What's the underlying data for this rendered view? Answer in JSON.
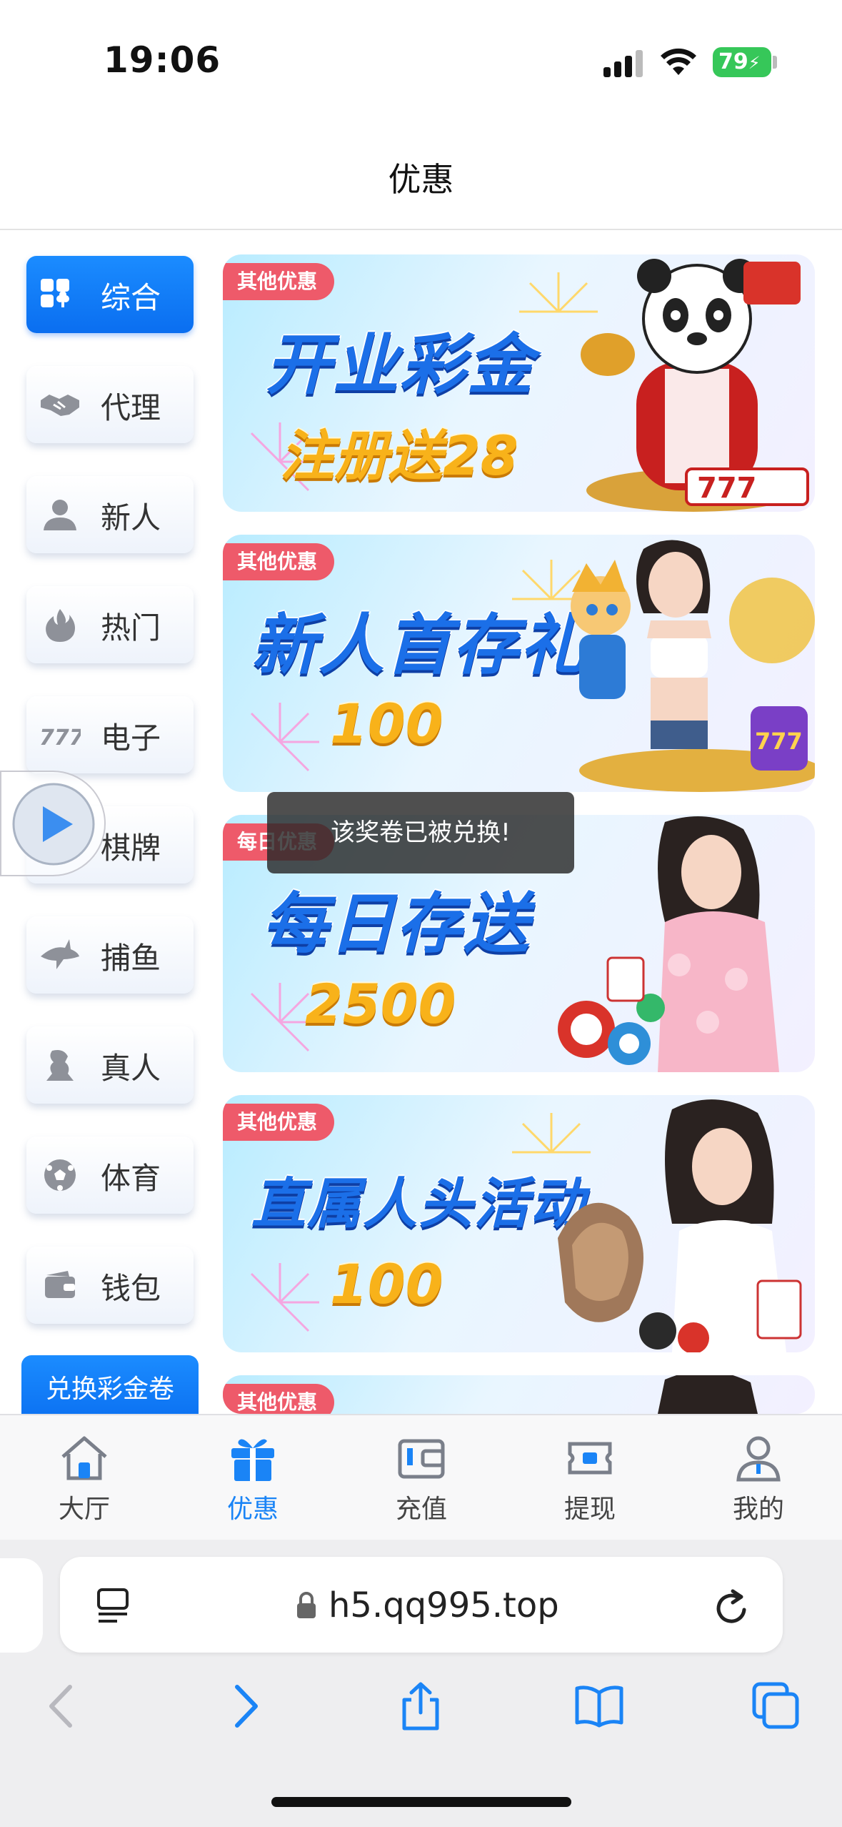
{
  "status_bar": {
    "time": "19:06",
    "battery": "79"
  },
  "header": {
    "title": "优惠"
  },
  "side_menu": {
    "items": [
      {
        "label": "综合",
        "icon": "grid-club-icon",
        "active": true
      },
      {
        "label": "代理",
        "icon": "handshake-icon",
        "active": false
      },
      {
        "label": "新人",
        "icon": "person-icon",
        "active": false
      },
      {
        "label": "热门",
        "icon": "fire-icon",
        "active": false
      },
      {
        "label": "电子",
        "icon": "slot-777-icon",
        "active": false
      },
      {
        "label": "棋牌",
        "icon": "cards-icon",
        "active": false
      },
      {
        "label": "捕鱼",
        "icon": "shark-icon",
        "active": false
      },
      {
        "label": "真人",
        "icon": "dealer-icon",
        "active": false
      },
      {
        "label": "体育",
        "icon": "soccer-ball-icon",
        "active": false
      },
      {
        "label": "钱包",
        "icon": "wallet-icon",
        "active": false
      }
    ],
    "redeem_label": "兑换彩金卷"
  },
  "banners": [
    {
      "tag": "其他优惠",
      "title": "开业彩金",
      "subtitle": "注册送28",
      "art": "panda-mascot"
    },
    {
      "tag": "其他优惠",
      "title": "新人首存礼",
      "subtitle": "100",
      "art": "girl-and-cartoon-boy"
    },
    {
      "tag": "每日优惠",
      "title": "每日存送",
      "subtitle": "2500",
      "art": "girl-with-chips"
    },
    {
      "tag": "其他优惠",
      "title": "直属人头活动",
      "subtitle": "100",
      "art": "girl-with-cards"
    },
    {
      "tag": "其他优惠",
      "title": "",
      "subtitle": "",
      "art": "girl-partial"
    }
  ],
  "toast": {
    "message": "该奖卷已被兑换!"
  },
  "bottom_nav": [
    {
      "label": "大厅",
      "icon": "home-icon",
      "active": false
    },
    {
      "label": "优惠",
      "icon": "gift-icon",
      "active": true
    },
    {
      "label": "充值",
      "icon": "deposit-wallet-icon",
      "active": false
    },
    {
      "label": "提现",
      "icon": "withdraw-icon",
      "active": false
    },
    {
      "label": "我的",
      "icon": "profile-icon",
      "active": false
    }
  ],
  "browser": {
    "url": "h5.qq995.top"
  },
  "colors": {
    "accent": "#1a84f6",
    "tag_red": "#ee5a6a",
    "banner_title_blue": "#1b6fe8",
    "banner_number_gold": "#f8b21a"
  }
}
